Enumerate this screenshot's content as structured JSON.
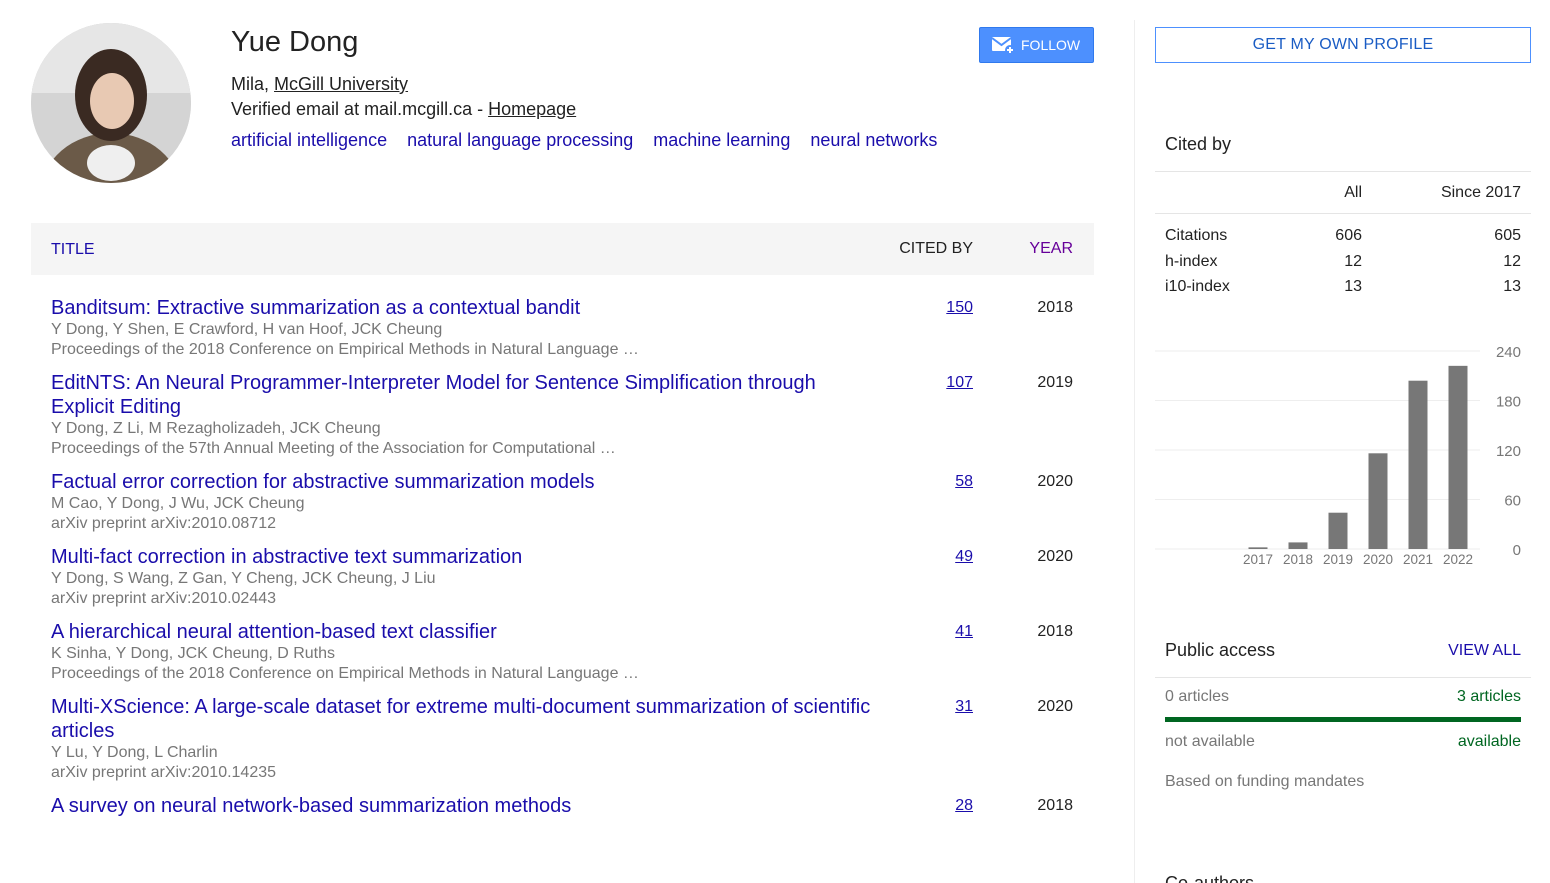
{
  "profile": {
    "name": "Yue Dong",
    "affiliation_prefix": "Mila, ",
    "affiliation_link": "McGill University",
    "email_text": "Verified email at mail.mcgill.ca - ",
    "homepage_link": "Homepage",
    "interests": [
      "artificial intelligence",
      "natural language processing",
      "machine learning",
      "neural networks"
    ],
    "follow_label": "FOLLOW"
  },
  "table": {
    "headers": {
      "title": "TITLE",
      "cited_by": "CITED BY",
      "year": "YEAR"
    },
    "rows": [
      {
        "title": "Banditsum: Extractive summarization as a contextual bandit",
        "authors": "Y Dong, Y Shen, E Crawford, H van Hoof, JCK Cheung",
        "venue": "Proceedings of the 2018 Conference on Empirical Methods in Natural Language …",
        "cited": "150",
        "year": "2018"
      },
      {
        "title": "EditNTS: An Neural Programmer-Interpreter Model for Sentence Simplification through Explicit Editing",
        "authors": "Y Dong, Z Li, M Rezagholizadeh, JCK Cheung",
        "venue": "Proceedings of the 57th Annual Meeting of the Association for Computational …",
        "cited": "107",
        "year": "2019"
      },
      {
        "title": "Factual error correction for abstractive summarization models",
        "authors": "M Cao, Y Dong, J Wu, JCK Cheung",
        "venue": "arXiv preprint arXiv:2010.08712",
        "cited": "58",
        "year": "2020"
      },
      {
        "title": "Multi-fact correction in abstractive text summarization",
        "authors": "Y Dong, S Wang, Z Gan, Y Cheng, JCK Cheung, J Liu",
        "venue": "arXiv preprint arXiv:2010.02443",
        "cited": "49",
        "year": "2020"
      },
      {
        "title": "A hierarchical neural attention-based text classifier",
        "authors": "K Sinha, Y Dong, JCK Cheung, D Ruths",
        "venue": "Proceedings of the 2018 Conference on Empirical Methods in Natural Language …",
        "cited": "41",
        "year": "2018"
      },
      {
        "title": "Multi-XScience: A large-scale dataset for extreme multi-document summarization of scientific articles",
        "authors": "Y Lu, Y Dong, L Charlin",
        "venue": "arXiv preprint arXiv:2010.14235",
        "cited": "31",
        "year": "2020"
      },
      {
        "title": "A survey on neural network-based summarization methods",
        "authors": "",
        "venue": "",
        "cited": "28",
        "year": "2018"
      }
    ]
  },
  "sidebar": {
    "own_profile_label": "GET MY OWN PROFILE",
    "cited_by": {
      "heading": "Cited by",
      "col_all": "All",
      "col_since": "Since 2017",
      "stats": [
        {
          "label": "Citations",
          "all": "606",
          "since": "605"
        },
        {
          "label": "h-index",
          "all": "12",
          "since": "12"
        },
        {
          "label": "i10-index",
          "all": "13",
          "since": "13"
        }
      ]
    },
    "public_access": {
      "heading": "Public access",
      "view_all": "VIEW ALL",
      "not_available_count": "0 articles",
      "available_count": "3 articles",
      "available_fraction": 1.0,
      "not_available_label": "not available",
      "available_label": "available",
      "note": "Based on funding mandates"
    },
    "coauthors_heading": "Co-authors"
  },
  "colors": {
    "link": "#1a0dab",
    "accent": "#4d90fe",
    "green": "#006621",
    "bar": "#777777"
  },
  "chart_data": {
    "type": "bar",
    "categories": [
      "2017",
      "2018",
      "2019",
      "2020",
      "2021",
      "2022"
    ],
    "values": [
      2,
      8,
      44,
      116,
      204,
      222
    ],
    "ylim": [
      0,
      240
    ],
    "yticks": [
      0,
      60,
      120,
      180,
      240
    ],
    "title": "",
    "xlabel": "",
    "ylabel": ""
  }
}
